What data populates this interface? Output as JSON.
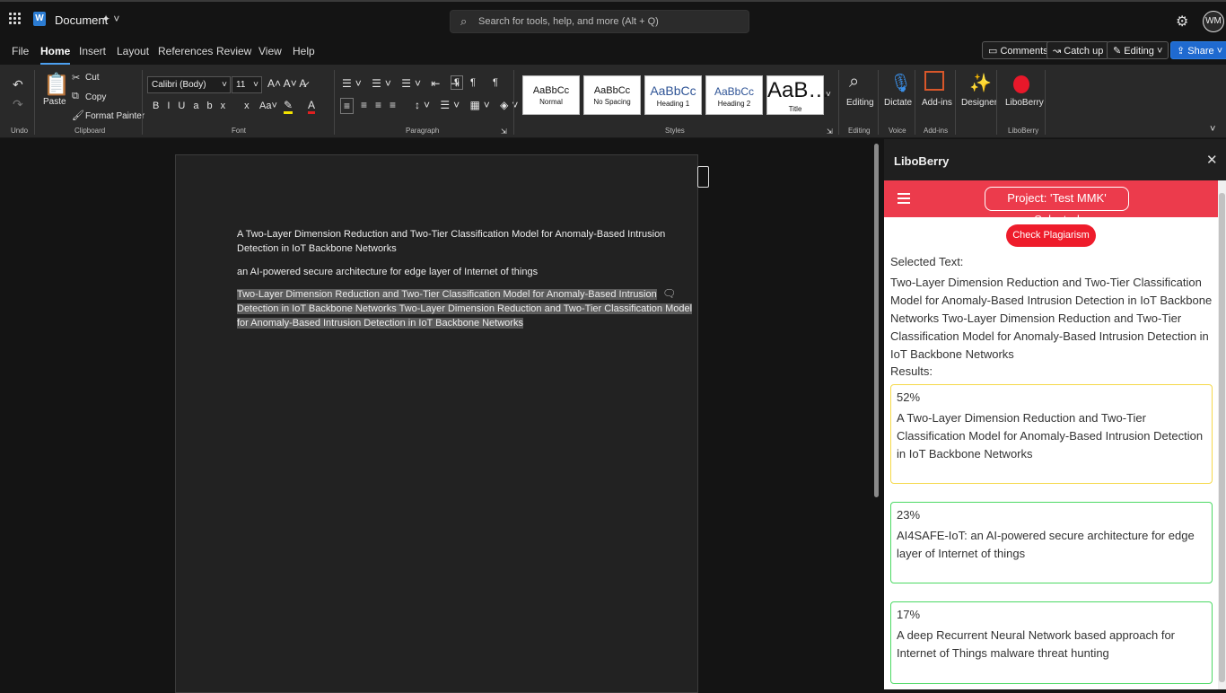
{
  "app": {
    "doc_title": "Document",
    "search_placeholder": "Search for tools, help, and more (Alt + Q)",
    "avatar": "WM"
  },
  "menu": [
    "File",
    "Home",
    "Insert",
    "Layout",
    "References",
    "Review",
    "View",
    "Help"
  ],
  "top_buttons": {
    "comments": "Comments",
    "catchup": "Catch up",
    "editing": "Editing",
    "share": "Share"
  },
  "ribbon": {
    "undo_label": "Undo",
    "clipboard": {
      "paste": "Paste",
      "cut": "Cut",
      "copy": "Copy",
      "format_painter": "Format Painter",
      "label": "Clipboard"
    },
    "font": {
      "family": "Calibri (Body)",
      "size": "11",
      "label": "Font"
    },
    "paragraph_label": "Paragraph",
    "styles": [
      {
        "preview": "AaBbCc",
        "name": "Normal"
      },
      {
        "preview": "AaBbCc",
        "name": "No Spacing"
      },
      {
        "preview": "AaBbCc",
        "name": "Heading 1"
      },
      {
        "preview": "AaBbCc",
        "name": "Heading 2"
      },
      {
        "preview": "AaB…",
        "name": "Title"
      }
    ],
    "styles_label": "Styles",
    "editing": "Editing",
    "dictate": "Dictate",
    "voice_label": "Voice",
    "addins": "Add-ins",
    "designer": "Designer",
    "liboberry": "LiboBerry"
  },
  "document": {
    "p1": "A Two-Layer Dimension Reduction and Two-Tier Classification Model for Anomaly-Based Intrusion",
    "p1b": "Detection in IoT Backbone Networks",
    "p2": "an AI-powered secure architecture for edge layer of Internet of things",
    "p3a": "Two-Layer Dimension Reduction and Two-Tier Classification Model for Anomaly-Based Intrusion",
    "p3b": "Detection in IoT Backbone Networks Two-Layer Dimension Reduction and Two-Tier Classification Model",
    "p3c": "for Anomaly-Based Intrusion Detection in IoT Backbone Networks"
  },
  "pane": {
    "title": "LiboBerry",
    "project": "Project: 'Test MMK' Selected",
    "check_button": "Check Plagiarism",
    "selected_label": "Selected Text:",
    "selected_text": "Two-Layer Dimension Reduction and Two-Tier Classification Model for Anomaly-Based Intrusion Detection in IoT Backbone Networks Two-Layer Dimension Reduction and Two-Tier Classification Model for Anomaly-Based Intrusion Detection in IoT Backbone Networks",
    "results_label": "Results:",
    "results": [
      {
        "pct": "52%",
        "text": "A Two-Layer Dimension Reduction and Two-Tier Classification Model for Anomaly-Based Intrusion Detection in IoT Backbone Networks",
        "color": "#f5d94a"
      },
      {
        "pct": "23%",
        "text": "AI4SAFE-IoT: an AI-powered secure architecture for edge layer of Internet of things",
        "color": "#4cd964"
      },
      {
        "pct": "17%",
        "text": "A deep Recurrent Neural Network based approach for Internet of Things malware threat hunting",
        "color": "#4cd964"
      }
    ]
  }
}
